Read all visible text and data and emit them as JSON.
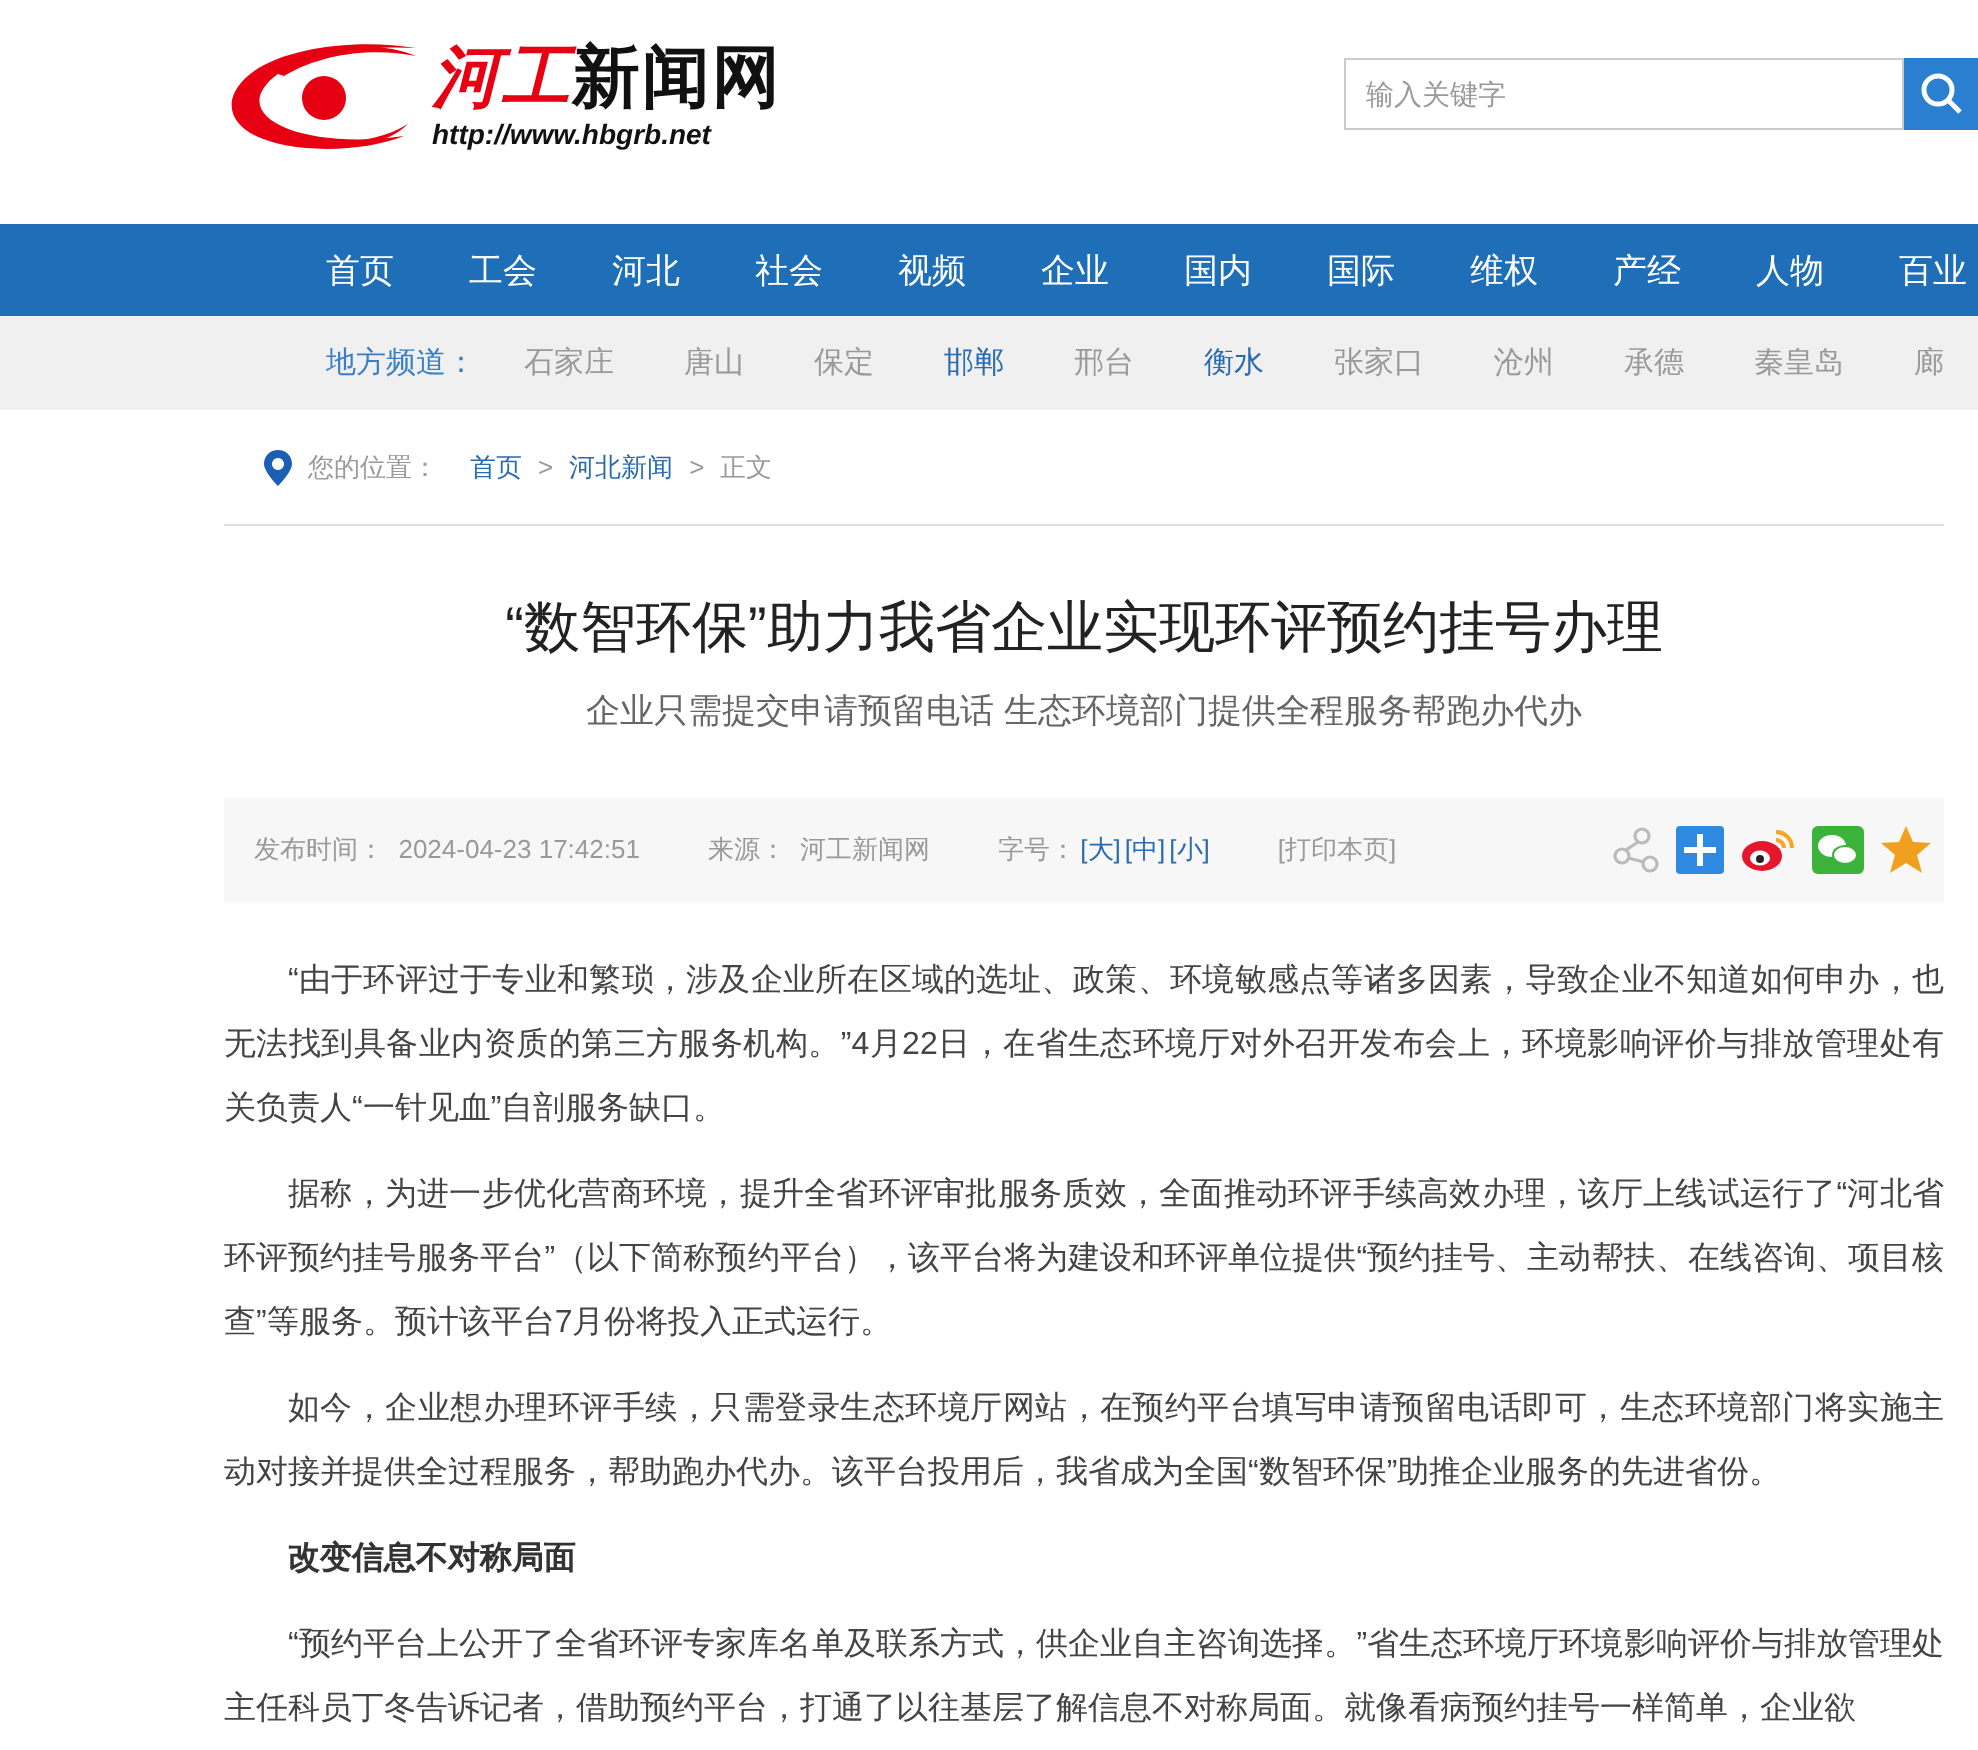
{
  "header": {
    "logo": {
      "name_red": "河工",
      "name_black": "新闻网",
      "url": "http://www.hbgrb.net"
    },
    "search": {
      "placeholder": "输入关键字"
    }
  },
  "nav": [
    "首页",
    "工会",
    "河北",
    "社会",
    "视频",
    "企业",
    "国内",
    "国际",
    "维权",
    "产经",
    "人物",
    "百业"
  ],
  "regions": {
    "label": "地方频道：",
    "items": [
      {
        "label": "石家庄",
        "highlighted": false
      },
      {
        "label": "唐山",
        "highlighted": false
      },
      {
        "label": "保定",
        "highlighted": false
      },
      {
        "label": "邯郸",
        "highlighted": true
      },
      {
        "label": "邢台",
        "highlighted": false
      },
      {
        "label": "衡水",
        "highlighted": true
      },
      {
        "label": "张家口",
        "highlighted": false
      },
      {
        "label": "沧州",
        "highlighted": false
      },
      {
        "label": "承德",
        "highlighted": false
      },
      {
        "label": "秦皇岛",
        "highlighted": false
      },
      {
        "label": "廊",
        "highlighted": false
      }
    ]
  },
  "breadcrumb": {
    "label": "您的位置：",
    "links": [
      "首页",
      "河北新闻"
    ],
    "current": "正文",
    "separators": [
      ">",
      ">"
    ]
  },
  "article": {
    "title": "“数智环保”助力我省企业实现环评预约挂号办理",
    "subtitle": "企业只需提交申请预留电话 生态环境部门提供全程服务帮跑办代办",
    "meta": {
      "time_label": "发布时间：",
      "time": "2024-04-23 17:42:51",
      "source_label": "来源：",
      "source": "河工新闻网",
      "size_label": "字号：",
      "sizes": [
        "[大]",
        "[中]",
        "[小]"
      ],
      "print": "[打印本页]"
    },
    "paragraphs": [
      {
        "kind": "text",
        "text": "“由于环评过于专业和繁琐，涉及企业所在区域的选址、政策、环境敏感点等诸多因素，导致企业不知道如何申办，也无法找到具备业内资质的第三方服务机构。”4月22日，在省生态环境厅对外召开发布会上，环境影响评价与排放管理处有关负责人“一针见血”自剖服务缺口。"
      },
      {
        "kind": "text",
        "text": "据称，为进一步优化营商环境，提升全省环评审批服务质效，全面推动环评手续高效办理，该厅上线试运行了“河北省环评预约挂号服务平台”（以下简称预约平台），该平台将为建设和环评单位提供“预约挂号、主动帮扶、在线咨询、项目核查”等服务。预计该平台7月份将投入正式运行。"
      },
      {
        "kind": "text",
        "text": "如今，企业想办理环评手续，只需登录生态环境厅网站，在预约平台填写申请预留电话即可，生态环境部门将实施主动对接并提供全过程服务，帮助跑办代办。该平台投用后，我省成为全国“数智环保”助推企业服务的先进省份。"
      },
      {
        "kind": "heading",
        "text": "改变信息不对称局面"
      },
      {
        "kind": "text",
        "text": "“预约平台上公开了全省环评专家库名单及联系方式，供企业自主咨询选择。”省生态环境厅环境影响评价与排放管理处主任科员丁冬告诉记者，借助预约平台，打通了以往基层了解信息不对称局面。就像看病预约挂号一样简单，企业欲"
      }
    ]
  }
}
